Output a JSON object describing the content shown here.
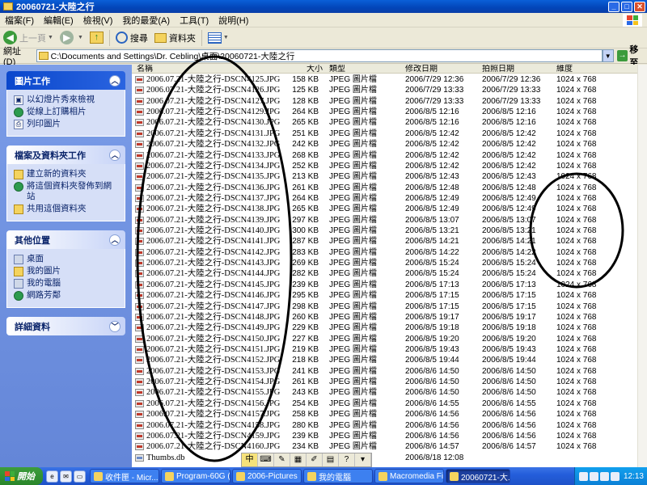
{
  "window": {
    "title": "20060721-大陸之行"
  },
  "menu": [
    "檔案(F)",
    "編輯(E)",
    "檢視(V)",
    "我的最愛(A)",
    "工具(T)",
    "說明(H)"
  ],
  "toolbar": {
    "back": "上一頁",
    "search": "搜尋",
    "folders": "資料夾"
  },
  "address": {
    "label": "網址(D)",
    "path": "C:\\Documents and Settings\\Dr. Cebling\\桌面\\20060721-大陸之行",
    "go": "移至"
  },
  "tasks": {
    "picture": {
      "title": "圖片工作",
      "items": [
        "以幻燈片秀來檢視",
        "從線上訂購相片",
        "列印圖片"
      ]
    },
    "file": {
      "title": "檔案及資料夾工作",
      "items": [
        "建立新的資料夾",
        "將這個資料夾發佈到網站",
        "共用這個資料夾"
      ]
    },
    "other": {
      "title": "其他位置",
      "items": [
        "桌面",
        "我的圖片",
        "我的電腦",
        "網路芳鄰"
      ]
    },
    "details": {
      "title": "詳細資料"
    }
  },
  "columns": {
    "name": "名稱",
    "size": "大小",
    "type": "類型",
    "modified": "修改日期",
    "taken": "拍照日期",
    "dimensions": "維度"
  },
  "files": [
    {
      "name": "2006.07.21-大陸之行-DSCN4125.JPG",
      "size": "158 KB",
      "type": "JPEG 圖片檔",
      "modified": "2006/7/29 12:36",
      "taken": "2006/7/29 12:36",
      "dim": "1024 x 768"
    },
    {
      "name": "2006.07.21-大陸之行-DSCN4126.JPG",
      "size": "125 KB",
      "type": "JPEG 圖片檔",
      "modified": "2006/7/29 13:33",
      "taken": "2006/7/29 13:33",
      "dim": "1024 x 768"
    },
    {
      "name": "2006.07.21-大陸之行-DSCN4127.JPG",
      "size": "128 KB",
      "type": "JPEG 圖片檔",
      "modified": "2006/7/29 13:33",
      "taken": "2006/7/29 13:33",
      "dim": "1024 x 768"
    },
    {
      "name": "2006.07.21-大陸之行-DSCN4129.JPG",
      "size": "264 KB",
      "type": "JPEG 圖片檔",
      "modified": "2006/8/5 12:16",
      "taken": "2006/8/5 12:16",
      "dim": "1024 x 768"
    },
    {
      "name": "2006.07.21-大陸之行-DSCN4130.JPG",
      "size": "265 KB",
      "type": "JPEG 圖片檔",
      "modified": "2006/8/5 12:16",
      "taken": "2006/8/5 12:16",
      "dim": "1024 x 768"
    },
    {
      "name": "2006.07.21-大陸之行-DSCN4131.JPG",
      "size": "251 KB",
      "type": "JPEG 圖片檔",
      "modified": "2006/8/5 12:42",
      "taken": "2006/8/5 12:42",
      "dim": "1024 x 768"
    },
    {
      "name": "2006.07.21-大陸之行-DSCN4132.JPG",
      "size": "242 KB",
      "type": "JPEG 圖片檔",
      "modified": "2006/8/5 12:42",
      "taken": "2006/8/5 12:42",
      "dim": "1024 x 768"
    },
    {
      "name": "2006.07.21-大陸之行-DSCN4133.JPG",
      "size": "268 KB",
      "type": "JPEG 圖片檔",
      "modified": "2006/8/5 12:42",
      "taken": "2006/8/5 12:42",
      "dim": "1024 x 768"
    },
    {
      "name": "2006.07.21-大陸之行-DSCN4134.JPG",
      "size": "252 KB",
      "type": "JPEG 圖片檔",
      "modified": "2006/8/5 12:42",
      "taken": "2006/8/5 12:42",
      "dim": "1024 x 768"
    },
    {
      "name": "2006.07.21-大陸之行-DSCN4135.JPG",
      "size": "213 KB",
      "type": "JPEG 圖片檔",
      "modified": "2006/8/5 12:43",
      "taken": "2006/8/5 12:43",
      "dim": "1024 x 768"
    },
    {
      "name": "2006.07.21-大陸之行-DSCN4136.JPG",
      "size": "261 KB",
      "type": "JPEG 圖片檔",
      "modified": "2006/8/5 12:48",
      "taken": "2006/8/5 12:48",
      "dim": "1024 x 768"
    },
    {
      "name": "2006.07.21-大陸之行-DSCN4137.JPG",
      "size": "264 KB",
      "type": "JPEG 圖片檔",
      "modified": "2006/8/5 12:49",
      "taken": "2006/8/5 12:49",
      "dim": "1024 x 768"
    },
    {
      "name": "2006.07.21-大陸之行-DSCN4138.JPG",
      "size": "265 KB",
      "type": "JPEG 圖片檔",
      "modified": "2006/8/5 12:49",
      "taken": "2006/8/5 12:49",
      "dim": "1024 x 768"
    },
    {
      "name": "2006.07.21-大陸之行-DSCN4139.JPG",
      "size": "297 KB",
      "type": "JPEG 圖片檔",
      "modified": "2006/8/5 13:07",
      "taken": "2006/8/5 13:07",
      "dim": "1024 x 768"
    },
    {
      "name": "2006.07.21-大陸之行-DSCN4140.JPG",
      "size": "300 KB",
      "type": "JPEG 圖片檔",
      "modified": "2006/8/5 13:21",
      "taken": "2006/8/5 13:21",
      "dim": "1024 x 768"
    },
    {
      "name": "2006.07.21-大陸之行-DSCN4141.JPG",
      "size": "287 KB",
      "type": "JPEG 圖片檔",
      "modified": "2006/8/5 14:21",
      "taken": "2006/8/5 14:21",
      "dim": "1024 x 768"
    },
    {
      "name": "2006.07.21-大陸之行-DSCN4142.JPG",
      "size": "283 KB",
      "type": "JPEG 圖片檔",
      "modified": "2006/8/5 14:22",
      "taken": "2006/8/5 14:22",
      "dim": "1024 x 768"
    },
    {
      "name": "2006.07.21-大陸之行-DSCN4143.JPG",
      "size": "269 KB",
      "type": "JPEG 圖片檔",
      "modified": "2006/8/5 15:24",
      "taken": "2006/8/5 15:24",
      "dim": "1024 x 768"
    },
    {
      "name": "2006.07.21-大陸之行-DSCN4144.JPG",
      "size": "282 KB",
      "type": "JPEG 圖片檔",
      "modified": "2006/8/5 15:24",
      "taken": "2006/8/5 15:24",
      "dim": "1024 x 768"
    },
    {
      "name": "2006.07.21-大陸之行-DSCN4145.JPG",
      "size": "239 KB",
      "type": "JPEG 圖片檔",
      "modified": "2006/8/5 17:13",
      "taken": "2006/8/5 17:13",
      "dim": "1024 x 768"
    },
    {
      "name": "2006.07.21-大陸之行-DSCN4146.JPG",
      "size": "295 KB",
      "type": "JPEG 圖片檔",
      "modified": "2006/8/5 17:15",
      "taken": "2006/8/5 17:15",
      "dim": "1024 x 768"
    },
    {
      "name": "2006.07.21-大陸之行-DSCN4147.JPG",
      "size": "298 KB",
      "type": "JPEG 圖片檔",
      "modified": "2006/8/5 17:15",
      "taken": "2006/8/5 17:15",
      "dim": "1024 x 768"
    },
    {
      "name": "2006.07.21-大陸之行-DSCN4148.JPG",
      "size": "260 KB",
      "type": "JPEG 圖片檔",
      "modified": "2006/8/5 19:17",
      "taken": "2006/8/5 19:17",
      "dim": "1024 x 768"
    },
    {
      "name": "2006.07.21-大陸之行-DSCN4149.JPG",
      "size": "229 KB",
      "type": "JPEG 圖片檔",
      "modified": "2006/8/5 19:18",
      "taken": "2006/8/5 19:18",
      "dim": "1024 x 768"
    },
    {
      "name": "2006.07.21-大陸之行-DSCN4150.JPG",
      "size": "227 KB",
      "type": "JPEG 圖片檔",
      "modified": "2006/8/5 19:20",
      "taken": "2006/8/5 19:20",
      "dim": "1024 x 768"
    },
    {
      "name": "2006.07.21-大陸之行-DSCN4151.JPG",
      "size": "219 KB",
      "type": "JPEG 圖片檔",
      "modified": "2006/8/5 19:43",
      "taken": "2006/8/5 19:43",
      "dim": "1024 x 768"
    },
    {
      "name": "2006.07.21-大陸之行-DSCN4152.JPG",
      "size": "218 KB",
      "type": "JPEG 圖片檔",
      "modified": "2006/8/5 19:44",
      "taken": "2006/8/5 19:44",
      "dim": "1024 x 768"
    },
    {
      "name": "2006.07.21-大陸之行-DSCN4153.JPG",
      "size": "241 KB",
      "type": "JPEG 圖片檔",
      "modified": "2006/8/6 14:50",
      "taken": "2006/8/6 14:50",
      "dim": "1024 x 768"
    },
    {
      "name": "2006.07.21-大陸之行-DSCN4154.JPG",
      "size": "261 KB",
      "type": "JPEG 圖片檔",
      "modified": "2006/8/6 14:50",
      "taken": "2006/8/6 14:50",
      "dim": "1024 x 768"
    },
    {
      "name": "2006.07.21-大陸之行-DSCN4155.JPG",
      "size": "243 KB",
      "type": "JPEG 圖片檔",
      "modified": "2006/8/6 14:50",
      "taken": "2006/8/6 14:50",
      "dim": "1024 x 768"
    },
    {
      "name": "2006.07.21-大陸之行-DSCN4156.JPG",
      "size": "254 KB",
      "type": "JPEG 圖片檔",
      "modified": "2006/8/6 14:55",
      "taken": "2006/8/6 14:55",
      "dim": "1024 x 768"
    },
    {
      "name": "2006.07.21-大陸之行-DSCN4157.JPG",
      "size": "258 KB",
      "type": "JPEG 圖片檔",
      "modified": "2006/8/6 14:56",
      "taken": "2006/8/6 14:56",
      "dim": "1024 x 768"
    },
    {
      "name": "2006.07.21-大陸之行-DSCN4158.JPG",
      "size": "280 KB",
      "type": "JPEG 圖片檔",
      "modified": "2006/8/6 14:56",
      "taken": "2006/8/6 14:56",
      "dim": "1024 x 768"
    },
    {
      "name": "2006.07.21-大陸之行-DSCN4159.JPG",
      "size": "239 KB",
      "type": "JPEG 圖片檔",
      "modified": "2006/8/6 14:56",
      "taken": "2006/8/6 14:56",
      "dim": "1024 x 768"
    },
    {
      "name": "2006.07.21-大陸之行-DSCN4160.JPG",
      "size": "234 KB",
      "type": "JPEG 圖片檔",
      "modified": "2006/8/6 14:57",
      "taken": "2006/8/6 14:57",
      "dim": "1024 x 768"
    },
    {
      "name": "Thumbs.db",
      "size": "",
      "type": "",
      "modified": "2006/8/18 12:08",
      "taken": "",
      "dim": ""
    }
  ],
  "taskbar": {
    "start": "開始",
    "tasks": [
      "收件匣 - Micr...",
      "Program-60G (...",
      "2006-Pictures",
      "我的電腦",
      "Macromedia Fi...",
      "20060721-大..."
    ],
    "clock": "12:13"
  }
}
